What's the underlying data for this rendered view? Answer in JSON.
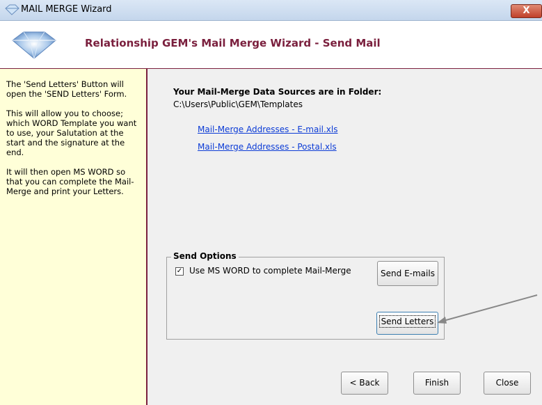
{
  "window": {
    "title": "MAIL MERGE Wizard",
    "close_glyph": "X"
  },
  "header": {
    "title": "Relationship GEM's Mail Merge Wizard - Send Mail",
    "logo_icon": "diamond-logo-icon"
  },
  "help_panel": {
    "paragraphs": [
      "The 'Send Letters' Button will open the 'SEND Letters' Form.",
      "This will allow you to choose; which WORD Template you want to use, your Salutation at the start and the signature at the end.",
      "It will then open MS WORD so that you can complete the Mail-Merge and print your Letters."
    ]
  },
  "data_sources": {
    "heading": "Your Mail-Merge Data Sources are in Folder:",
    "folder_path": "C:\\Users\\Public\\GEM\\Templates",
    "links": [
      "Mail-Merge Addresses - E-mail.xls",
      "Mail-Merge Addresses - Postal.xls"
    ]
  },
  "send_options": {
    "legend": "Send Options",
    "checkbox_label": "Use MS WORD to complete Mail-Merge",
    "checkbox_checked": true,
    "checkbox_mark": "✓",
    "send_emails_label": "Send E-mails",
    "send_letters_label": "Send Letters"
  },
  "footer": {
    "back_label": "< Back",
    "finish_label": "Finish",
    "close_label": "Close"
  },
  "colors": {
    "accent": "#7a1f3d",
    "link": "#0b3bd6",
    "help_bg": "#ffffd8"
  }
}
